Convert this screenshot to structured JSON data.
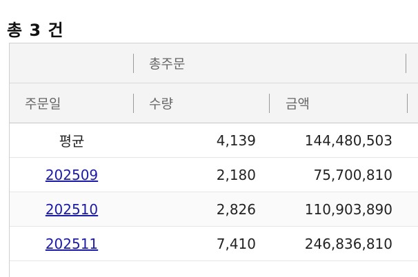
{
  "summary": {
    "total_label": "총 3 건"
  },
  "table": {
    "group_header": "총주문",
    "columns": {
      "date": "주문일",
      "qty": "수량",
      "amount": "금액"
    },
    "average_row": {
      "label": "평균",
      "qty": "4,139",
      "amount": "144,480,503"
    },
    "rows": [
      {
        "date": "202509",
        "qty": "2,180",
        "amount": "75,700,810"
      },
      {
        "date": "202510",
        "qty": "2,826",
        "amount": "110,903,890"
      },
      {
        "date": "202511",
        "qty": "7,410",
        "amount": "246,836,810"
      }
    ]
  }
}
